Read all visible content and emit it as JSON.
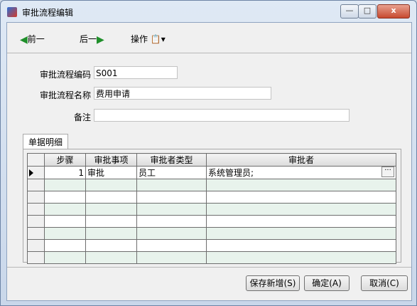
{
  "window": {
    "title": "审批流程编辑",
    "close_glyph": "x",
    "min_glyph": "—",
    "max_glyph": "□"
  },
  "toolbar": {
    "prev_label": "前一",
    "next_label": "后一",
    "ops_label": "操作"
  },
  "form": {
    "code_label": "审批流程编码",
    "code_value": "S001",
    "name_label": "审批流程名称",
    "name_value": "费用申请",
    "note_label": "备注",
    "note_value": ""
  },
  "tabs": [
    {
      "label": "单据明细"
    }
  ],
  "grid": {
    "columns": [
      "步骤",
      "审批事项",
      "审批者类型",
      "审批者"
    ],
    "rows": [
      {
        "step": "1",
        "item": "审批",
        "type": "员工",
        "approver": "系统管理员;"
      }
    ]
  },
  "buttons": {
    "save_new": "保存新增(S)",
    "ok": "确定(A)",
    "cancel": "取消(C)"
  },
  "colors": {
    "accent_arrow": "#1f8f2a",
    "alt_row": "#e8f3ec"
  }
}
